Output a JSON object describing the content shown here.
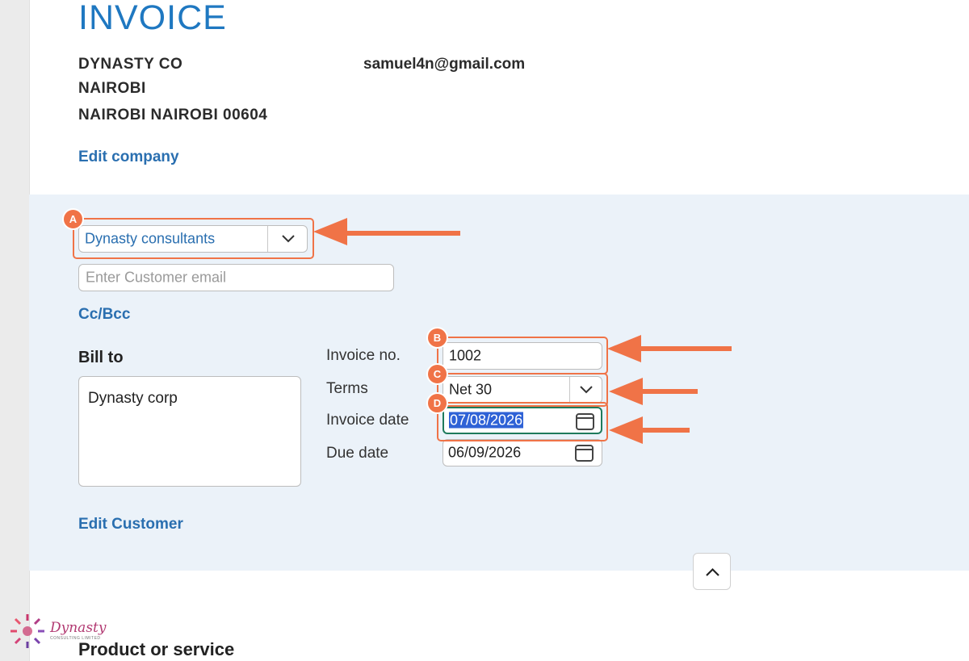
{
  "header": {
    "title": "INVOICE",
    "company_name": "DYNASTY CO",
    "company_city": "NAIROBI",
    "company_address": "NAIROBI NAIROBI 00604",
    "company_email": "samuel4n@gmail.com",
    "edit_company": "Edit company"
  },
  "customer": {
    "selected": "Dynasty consultants",
    "email_placeholder": "Enter Customer email",
    "cc_bcc": "Cc/Bcc",
    "bill_to_label": "Bill to",
    "bill_to_value": "Dynasty corp",
    "edit_customer": "Edit Customer"
  },
  "invoice_fields": {
    "invoice_no_label": "Invoice no.",
    "invoice_no_value": "1002",
    "terms_label": "Terms",
    "terms_value": "Net 30",
    "invoice_date_label": "Invoice date",
    "invoice_date_value": "07/08/2026",
    "due_date_label": "Due date",
    "due_date_value": "06/09/2026"
  },
  "callouts": {
    "a": "A",
    "b": "B",
    "c": "C",
    "d": "D",
    "color": "#f07347"
  },
  "section": {
    "product_heading": "Product or service"
  },
  "logo": {
    "text": "Dynasty",
    "subtext": "CONSULTING LIMITED"
  },
  "colors": {
    "title_blue": "#1f78c1",
    "link_blue": "#2a6fb0",
    "panel_bg": "#ebf2f9",
    "focus_green": "#1e7a5c",
    "selection_blue": "#2f62d6"
  }
}
